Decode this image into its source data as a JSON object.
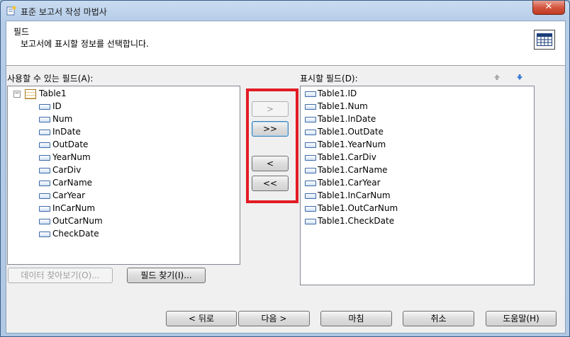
{
  "window": {
    "title": "표준 보고서 작성 마법사",
    "close_label": "✕"
  },
  "header": {
    "title": "필드",
    "subtitle": "보고서에 표시할 정보를 선택합니다."
  },
  "available": {
    "label": "사용할 수 있는 필드(A):",
    "table": "Table1",
    "fields": [
      "ID",
      "Num",
      "InDate",
      "OutDate",
      "YearNum",
      "CarDiv",
      "CarName",
      "CarYear",
      "InCarNum",
      "OutCarNum",
      "CheckDate"
    ]
  },
  "display": {
    "label": "표시할 필드(D):",
    "fields": [
      "Table1.ID",
      "Table1.Num",
      "Table1.InDate",
      "Table1.OutDate",
      "Table1.YearNum",
      "Table1.CarDiv",
      "Table1.CarName",
      "Table1.CarYear",
      "Table1.InCarNum",
      "Table1.OutCarNum",
      "Table1.CheckDate"
    ],
    "move_up_icon": "arrow-up-icon",
    "move_down_icon": "arrow-down-icon"
  },
  "move_buttons": {
    "add": ">",
    "add_all": ">>",
    "remove": "<",
    "remove_all": "<<"
  },
  "lower_buttons": {
    "browse_data": "데이터 찾아보기(O)...",
    "find_field": "필드 찾기(I)..."
  },
  "footer": {
    "back": "< 뒤로",
    "next": "다음 >",
    "finish": "마침",
    "cancel": "취소",
    "help": "도움말(H)"
  },
  "colors": {
    "highlight_frame": "#e21b24",
    "title_bar": "#b6cde8",
    "close_button": "#c23a22"
  }
}
